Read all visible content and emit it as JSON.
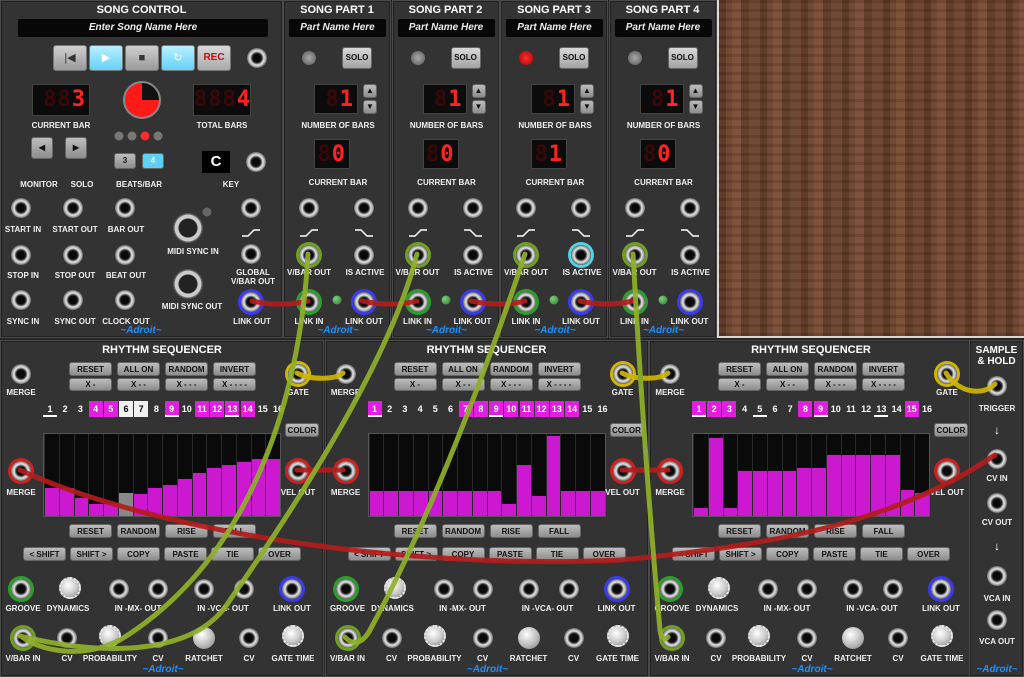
{
  "song_control": {
    "title": "SONG CONTROL",
    "song_name_placeholder": "Enter Song Name Here",
    "rec_label": "REC",
    "current_bar_value": "3",
    "current_bar_label": "CURRENT BAR",
    "total_bars_value": "4",
    "total_bars_label": "TOTAL BARS",
    "monitor_label": "MONITOR",
    "solo_label": "SOLO",
    "beats_options": [
      "3",
      "4"
    ],
    "beats_selected": "4",
    "beats_label": "BEATS/BAR",
    "key_value": "C",
    "key_label": "KEY",
    "start_in": "START IN",
    "start_out": "START OUT",
    "bar_out": "BAR OUT",
    "midi_sync_in": "MIDI SYNC IN",
    "stop_in": "STOP IN",
    "stop_out": "STOP OUT",
    "beat_out": "BEAT OUT",
    "global_vbar_out_1": "GLOBAL",
    "global_vbar_out_2": "V/BAR OUT",
    "sync_in": "SYNC IN",
    "sync_out": "SYNC OUT",
    "clock_out": "CLOCK OUT",
    "midi_sync_out": "MIDI SYNC OUT",
    "link_out": "LINK OUT",
    "brand": "~Adroit~"
  },
  "song_parts": [
    {
      "title": "SONG PART 1",
      "name_placeholder": "Part Name Here",
      "solo": "SOLO",
      "bars": "1",
      "bars_label": "NUMBER OF BARS",
      "current": "0",
      "current_label": "CURRENT BAR",
      "vbar_out": "V/BAR OUT",
      "is_active": "IS ACTIVE",
      "link_in": "LINK IN",
      "link_out": "LINK OUT",
      "brand": "~Adroit~",
      "active": false
    },
    {
      "title": "SONG PART 2",
      "name_placeholder": "Part Name Here",
      "solo": "SOLO",
      "bars": "1",
      "bars_label": "NUMBER OF BARS",
      "current": "0",
      "current_label": "CURRENT BAR",
      "vbar_out": "V/BAR OUT",
      "is_active": "IS ACTIVE",
      "link_in": "LINK IN",
      "link_out": "LINK OUT",
      "brand": "~Adroit~",
      "active": false
    },
    {
      "title": "SONG PART 3",
      "name_placeholder": "Part Name Here",
      "solo": "SOLO",
      "bars": "1",
      "bars_label": "NUMBER OF BARS",
      "current": "1",
      "current_label": "CURRENT BAR",
      "vbar_out": "V/BAR OUT",
      "is_active": "IS ACTIVE",
      "link_in": "LINK IN",
      "link_out": "LINK OUT",
      "brand": "~Adroit~",
      "active": true
    },
    {
      "title": "SONG PART 4",
      "name_placeholder": "Part Name Here",
      "solo": "SOLO",
      "bars": "1",
      "bars_label": "NUMBER OF BARS",
      "current": "0",
      "current_label": "CURRENT BAR",
      "vbar_out": "V/BAR OUT",
      "is_active": "IS ACTIVE",
      "link_in": "LINK IN",
      "link_out": "LINK OUT",
      "brand": "~Adroit~",
      "active": false
    }
  ],
  "sequencers": [
    {
      "title": "RHYTHM SEQUENCER",
      "steps_on": [
        4,
        5,
        6,
        7,
        9,
        11,
        12,
        13,
        14
      ],
      "steps_cur": [
        6,
        7
      ],
      "underline": [
        1,
        9,
        13
      ],
      "levels": [
        0.34,
        0.34,
        0.22,
        0.15,
        0.15,
        0.28,
        0.27,
        0.34,
        0.38,
        0.45,
        0.52,
        0.58,
        0.62,
        0.66,
        0.7,
        0.7
      ]
    },
    {
      "title": "RHYTHM SEQUENCER",
      "steps_on": [
        1,
        7,
        8,
        9,
        10,
        11,
        12,
        13,
        14
      ],
      "steps_cur": [],
      "underline": [
        1,
        9
      ],
      "levels": [
        0.3,
        0.3,
        0.3,
        0.3,
        0.3,
        0.3,
        0.3,
        0.3,
        0.3,
        0.15,
        0.62,
        0.25,
        0.98,
        0.3,
        0.3,
        0.3
      ]
    },
    {
      "title": "RHYTHM SEQUENCER",
      "steps_on": [
        1,
        2,
        3,
        8,
        9,
        15
      ],
      "steps_cur": [],
      "underline": [
        1,
        5,
        9,
        13
      ],
      "levels": [
        0.1,
        0.95,
        0.1,
        0.55,
        0.55,
        0.55,
        0.55,
        0.58,
        0.58,
        0.74,
        0.74,
        0.74,
        0.74,
        0.74,
        0.32,
        0.28
      ]
    }
  ],
  "seq_labels": {
    "merge": "MERGE",
    "gate": "GATE",
    "vel_out": "VEL OUT",
    "color": "COLOR",
    "reset": "RESET",
    "all_on": "ALL ON",
    "random": "RANDOM",
    "invert": "INVERT",
    "x1": "X -",
    "x2": "X - -",
    "x3": "X - - -",
    "x4": "X - - - -",
    "rise": "RISE",
    "fall": "FALL",
    "shift_l": "< SHIFT",
    "shift_r": "SHIFT >",
    "copy": "COPY",
    "paste": "PASTE",
    "tie": "TIE",
    "over": "OVER",
    "groove": "GROOVE",
    "dynamics": "DYNAMICS",
    "in_mx_out": "IN -MX- OUT",
    "in_vca_out": "IN -VCA- OUT",
    "link_out": "LINK OUT",
    "vbar_in": "V/BAR IN",
    "cv": "CV",
    "probability": "PROBABILITY",
    "ratchet": "RATCHET",
    "gate_time": "GATE TIME",
    "brand": "~Adroit~"
  },
  "sample_hold": {
    "title1": "SAMPLE",
    "title2": "& HOLD",
    "trigger": "TRIGGER",
    "cv_in": "CV IN",
    "cv_out": "CV OUT",
    "vca_in": "VCA IN",
    "vca_out": "VCA OUT",
    "brand": "~Adroit~"
  },
  "colors": {
    "magenta": "#e21fe0",
    "cable_green": "#8fb02a",
    "cable_red": "#b01a1a",
    "cable_yellow": "#c8b400",
    "led_red": "#ff2222"
  }
}
